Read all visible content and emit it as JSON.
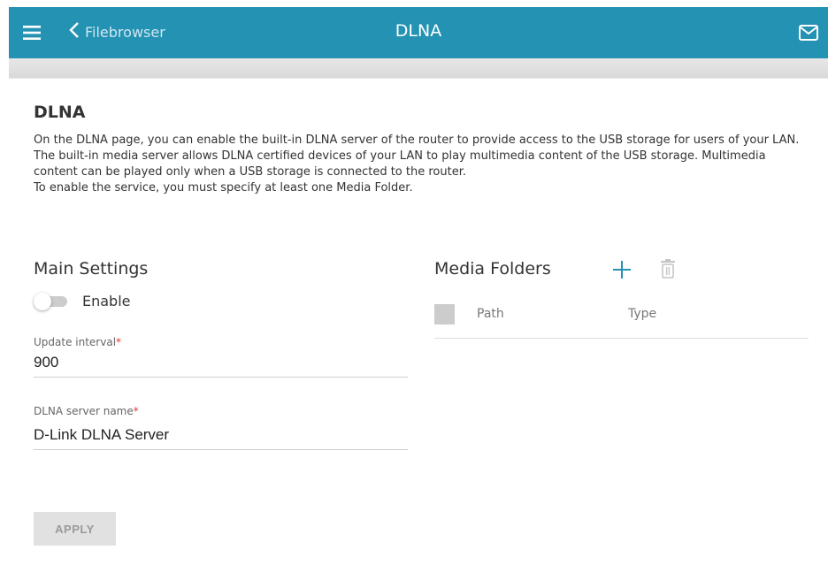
{
  "header": {
    "back_label": "Filebrowser",
    "title": "DLNA",
    "menu_icon": "hamburger-menu-icon",
    "back_icon": "chevron-left-icon",
    "mail_icon": "envelope-icon",
    "color": "#2492b3"
  },
  "page": {
    "title": "DLNA",
    "description": [
      "On the DLNA page, you can enable the built-in DLNA server of the router to provide access to the USB storage for users of your LAN.",
      "The built-in media server allows DLNA certified devices of your LAN to play multimedia content of the USB storage. Multimedia content can be played only when a USB storage is connected to the router.",
      "To enable the service, you must specify at least one Media Folder."
    ]
  },
  "main_settings": {
    "title": "Main Settings",
    "enable_label": "Enable",
    "enabled": false,
    "update_interval": {
      "label": "Update interval",
      "required_mark": "*",
      "value": "900"
    },
    "server_name": {
      "label": "DLNA server name",
      "required_mark": "*",
      "value": "D-Link DLNA Server"
    }
  },
  "media_folders": {
    "title": "Media Folders",
    "add_icon": "plus-icon",
    "delete_icon": "trash-icon",
    "columns": [
      "Path",
      "Type"
    ],
    "rows": []
  },
  "actions": {
    "apply_label": "APPLY"
  }
}
